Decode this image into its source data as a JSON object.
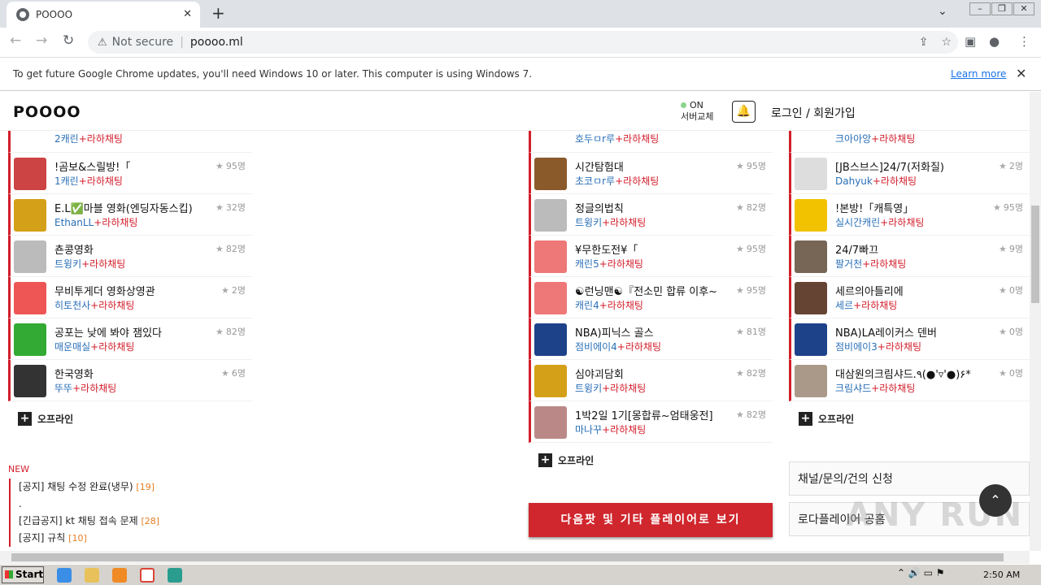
{
  "browser": {
    "tab_title": "POOOO",
    "new_tab": "+",
    "security": "Not secure",
    "url": "poooo.ml",
    "infobar_message": "To get future Google Chrome updates, you'll need Windows 10 or later. This computer is using Windows 7.",
    "learn_more": "Learn more"
  },
  "site": {
    "logo": "POOOO",
    "status_on": "ON",
    "status_sub": "서버교체",
    "login": "로그인 / 회원가입",
    "offline": "오프라인"
  },
  "col1": {
    "partial_sub_who": "2캐린",
    "partial_sub_tag": "+라하채팅",
    "rows": [
      {
        "name": "!곰보&스릴방!「",
        "who": "1캐린",
        "tag": "+라하채팅",
        "count": "95명",
        "color": "#c44"
      },
      {
        "name": "E.L✅마블 영화(엔딩자동스킵)",
        "who": "EthanLL",
        "tag": "+라하채팅",
        "count": "32명",
        "color": "#d4a017"
      },
      {
        "name": "쵼콩영화",
        "who": "트윙키",
        "tag": "+라하채팅",
        "count": "82명",
        "color": "#bbb"
      },
      {
        "name": "무비투게더 영화상영관",
        "who": "히토천사",
        "tag": "+라하채팅",
        "count": "2명",
        "color": "#e55"
      },
      {
        "name": "공포는 낮에 봐야 잼있다",
        "who": "매운매실",
        "tag": "+라하채팅",
        "count": "82명",
        "color": "#3a3"
      },
      {
        "name": "한국영화",
        "who": "뚜뚜",
        "tag": "+라하채팅",
        "count": "6명",
        "color": "#333"
      }
    ]
  },
  "col2": {
    "partial_sub_who": "호두ㅁr루",
    "partial_sub_tag": "+라하채팅",
    "rows": [
      {
        "name": "시간탐험대",
        "who": "초코ㅁr루",
        "tag": "+라하채팅",
        "count": "95명",
        "color": "#8b5a2b"
      },
      {
        "name": "정글의법칙",
        "who": "트윙키",
        "tag": "+라하채팅",
        "count": "82명",
        "color": "#bbb"
      },
      {
        "name": "¥무한도전¥「",
        "who": "캐린5",
        "tag": "+라하채팅",
        "count": "95명",
        "color": "#e77"
      },
      {
        "name": "☯런닝맨☯『전소민 합류 이후~",
        "who": "캐린4",
        "tag": "+라하채팅",
        "count": "95명",
        "color": "#e77"
      },
      {
        "name": "NBA)피닉스 골스",
        "who": "점비에이4",
        "tag": "+라하채팅",
        "count": "81명",
        "color": "#1d428a"
      },
      {
        "name": "심야괴담회",
        "who": "트윙키",
        "tag": "+라하채팅",
        "count": "82명",
        "color": "#d4a017"
      },
      {
        "name": "1박2일 1기[몽합류~엄태웅전]",
        "who": "마나꾸",
        "tag": "+라하채팅",
        "count": "82명",
        "color": "#b88"
      }
    ]
  },
  "col3": {
    "partial_sub_who": "크아아앙",
    "partial_sub_tag": "+라하채팅",
    "rows": [
      {
        "name": "[JB스브스]24/7(저화질)",
        "who": "Dahyuk",
        "tag": "+라하채팅",
        "count": "2명",
        "color": "#ddd"
      },
      {
        "name": "!본방!「캐특영」",
        "who": "실시간캐린",
        "tag": "+라하채팅",
        "count": "95명",
        "color": "#f2c200"
      },
      {
        "name": "24/7빠끄",
        "who": "팔거천",
        "tag": "+라하채팅",
        "count": "9명",
        "color": "#776655"
      },
      {
        "name": "세르의아틀리에",
        "who": "세르",
        "tag": "+라하채팅",
        "count": "0명",
        "color": "#664433"
      },
      {
        "name": "NBA)LA레이커스 덴버",
        "who": "점비에이3",
        "tag": "+라하채팅",
        "count": "0명",
        "color": "#1d428a"
      },
      {
        "name": "대삼원의크림샤드.٩(●'▿'●)۶*",
        "who": "크림샤드",
        "tag": "+라하채팅",
        "count": "0명",
        "color": "#a98"
      }
    ]
  },
  "notices": {
    "label": "NEW",
    "items": [
      {
        "text": "[공지] 채팅 수정 완료(냉무)",
        "num": "[19]"
      },
      {
        "text": ".",
        "num": ""
      },
      {
        "text": "[긴급공지] kt 채팅 접속 문제",
        "num": "[28]"
      },
      {
        "text": "[공지] 규칙",
        "num": "[10]"
      }
    ]
  },
  "buttons": {
    "next_page": "다음팟 및 기타 플레이어로 보기",
    "channel_request": "채널/문의/건의 신청",
    "roda_player": "로다플레이어 공홈"
  },
  "taskbar": {
    "start": "Start",
    "time": "2:50 AM"
  },
  "watermark": "ANY RUN"
}
